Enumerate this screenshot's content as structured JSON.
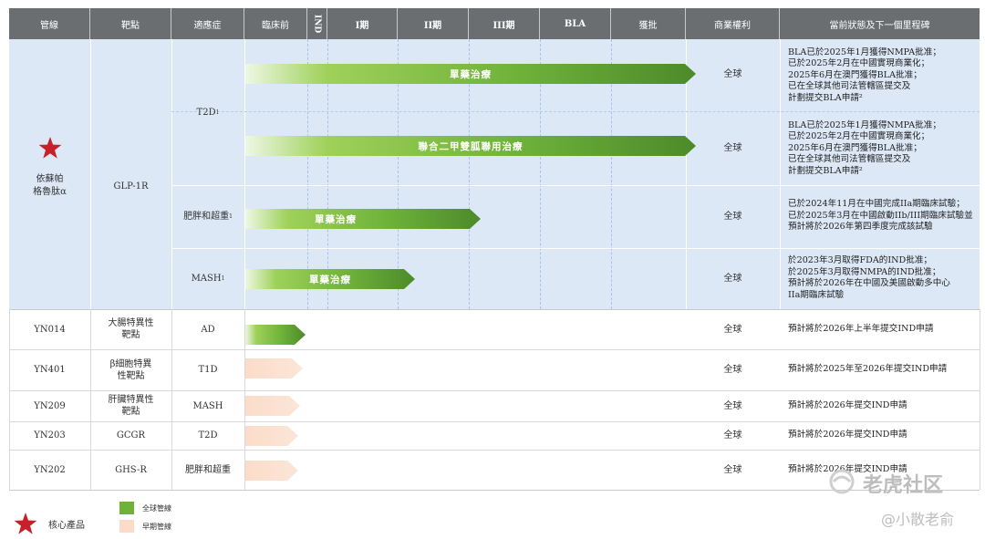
{
  "header": {
    "pipeline": "管線",
    "target": "靶點",
    "indication": "適應症",
    "preclinical": "臨床前",
    "ind": "IND",
    "phase1": "I期",
    "phase2": "II期",
    "phase3": "III期",
    "bla": "BLA",
    "approval": "獲批",
    "rights": "商業權利",
    "status": "當前狀態及下一個里程碑"
  },
  "main_product": {
    "name_line1": "依蘇帕",
    "name_line2": "格魯肽α",
    "target": "GLP-1R",
    "indications": [
      {
        "label": "T2D",
        "sup": "1",
        "rows": [
          {
            "bar_label": "單藥治療",
            "progress_stage": "BLA",
            "rights": "全球",
            "status": [
              "BLA已於2025年1月獲得NMPA批准；",
              "已於2025年2月在中國實現商業化；",
              "2025年6月在澳門獲得BLA批准；",
              "已在全球其他司法管轄區提交及",
              "計劃提交BLA申請²"
            ]
          },
          {
            "bar_label": "聯合二甲雙胍聯用治療",
            "progress_stage": "BLA",
            "rights": "全球",
            "status": [
              "BLA已於2025年1月獲得NMPA批准；",
              "已於2025年2月在中國實現商業化；",
              "2025年6月在澳門獲得BLA批准；",
              "已在全球其他司法管轄區提交及",
              "計劃提交BLA申請²"
            ]
          }
        ]
      },
      {
        "label": "肥胖和超重",
        "sup": "1",
        "rows": [
          {
            "bar_label": "單藥治療",
            "progress_stage": "III期",
            "rights": "全球",
            "status": [
              "已於2024年11月在中國完成IIa期臨床試驗；",
              "已於2025年3月在中國啟動IIb/III期臨床試驗並",
              "預計將於2026年第四季度完成該試驗"
            ]
          }
        ]
      },
      {
        "label": "MASH",
        "sup": "1",
        "rows": [
          {
            "bar_label": "單藥治療",
            "progress_stage": "II期",
            "rights": "全球",
            "status": [
              "於2023年3月取得FDA的IND批准；",
              "於2025年3月取得NMPA的IND批准；",
              "預計將於2026年在中國及美國啟動多中心",
              "IIa期臨床試驗"
            ]
          }
        ]
      }
    ]
  },
  "other_products": [
    {
      "name": "YN014",
      "target": "大腸特異性靶點",
      "target_lines": [
        "大腸特異性",
        "靶點"
      ],
      "indication": "AD",
      "pipeline_type": "全球管線",
      "progress_stage": "臨床前",
      "rights": "全球",
      "status": "預計將於2026年上半年提交IND申請"
    },
    {
      "name": "YN401",
      "target": "β細胞特異性靶點",
      "target_lines": [
        "β細胞特異",
        "性靶點"
      ],
      "indication": "T1D",
      "pipeline_type": "早期管線",
      "progress_stage": "臨床前",
      "rights": "全球",
      "status": "預計將於2025年至2026年提交IND申請"
    },
    {
      "name": "YN209",
      "target": "肝臟特異性靶點",
      "target_lines": [
        "肝臟特異性",
        "靶點"
      ],
      "indication": "MASH",
      "pipeline_type": "早期管線",
      "progress_stage": "臨床前",
      "rights": "全球",
      "status": "預計將於2026年提交IND申請"
    },
    {
      "name": "YN203",
      "target": "GCGR",
      "target_lines": [
        "GCGR"
      ],
      "indication": "T2D",
      "pipeline_type": "早期管線",
      "progress_stage": "臨床前",
      "rights": "全球",
      "status": "預計將於2026年提交IND申請"
    },
    {
      "name": "YN202",
      "target": "GHS-R",
      "target_lines": [
        "GHS-R"
      ],
      "indication": "肥胖和超重",
      "pipeline_type": "早期管線",
      "progress_stage": "臨床前",
      "rights": "全球",
      "status": "預計將於2026年提交IND申請"
    }
  ],
  "legend": {
    "core_product": "核心產品",
    "global_pipeline": "全球管線",
    "early_pipeline": "早期管線"
  },
  "watermark": {
    "brand": "老虎社区",
    "author": "@小散老俞"
  },
  "colors": {
    "header_bg": "#6b6e71",
    "group_bg": "#dce8f6",
    "green_bar": "#6fb23a",
    "peach_bar": "#fbdcc9",
    "star": "#c8202a"
  }
}
